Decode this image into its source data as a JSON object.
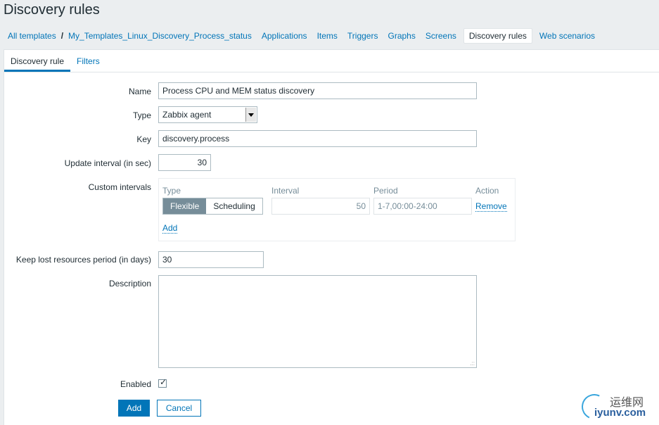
{
  "page": {
    "title": "Discovery rules"
  },
  "nav": {
    "all_templates": "All templates",
    "separator": "/",
    "template": "My_Templates_Linux_Discovery_Process_status",
    "items": [
      "Applications",
      "Items",
      "Triggers",
      "Graphs",
      "Screens",
      "Discovery rules",
      "Web scenarios"
    ],
    "active": "Discovery rules"
  },
  "tabs": [
    "Discovery rule",
    "Filters"
  ],
  "form": {
    "name_label": "Name",
    "name_value": "Process CPU and MEM status discovery",
    "type_label": "Type",
    "type_value": "Zabbix agent",
    "key_label": "Key",
    "key_value": "discovery.process",
    "update_label": "Update interval (in sec)",
    "update_value": "30",
    "custom_label": "Custom intervals",
    "custom": {
      "col_type": "Type",
      "col_interval": "Interval",
      "col_period": "Period",
      "col_action": "Action",
      "flexible": "Flexible",
      "scheduling": "Scheduling",
      "interval_value": "50",
      "period_value": "1-7,00:00-24:00",
      "remove": "Remove",
      "add": "Add"
    },
    "keep_label": "Keep lost resources period (in days)",
    "keep_value": "30",
    "description_label": "Description",
    "description_value": "",
    "enabled_label": "Enabled",
    "enabled_checked": true,
    "add_button": "Add",
    "cancel_button": "Cancel"
  },
  "watermark": {
    "cn": "运维网",
    "en": "iyunv.com"
  },
  "colors": {
    "link": "#0275b8",
    "background": "#ebeef0",
    "primary": "#0275b8"
  }
}
